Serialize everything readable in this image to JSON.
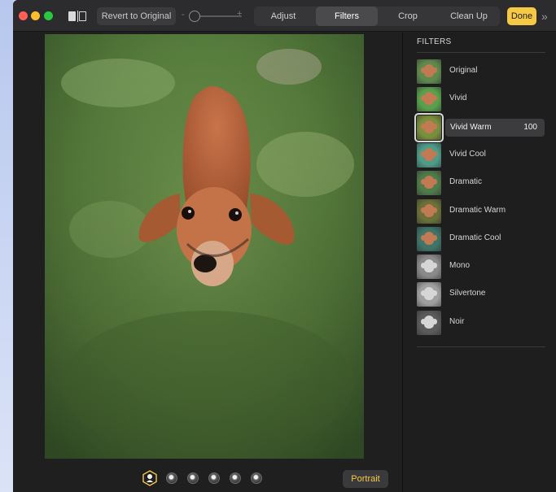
{
  "toolbar": {
    "revert_label": "Revert to Original",
    "zoom_minus": "-",
    "zoom_plus": "+",
    "tabs": [
      {
        "label": "Adjust",
        "active": false
      },
      {
        "label": "Filters",
        "active": true
      },
      {
        "label": "Crop",
        "active": false
      },
      {
        "label": "Clean Up",
        "active": false
      }
    ],
    "done_label": "Done",
    "more_glyph": "»"
  },
  "bottom": {
    "portrait_label": "Portrait",
    "lighting_options": [
      "natural",
      "studio",
      "contour",
      "stage",
      "stage-mono",
      "high-key-mono"
    ]
  },
  "sidebar": {
    "title": "FILTERS",
    "filters": [
      {
        "name": "Original",
        "tone": "#5e8a4e"
      },
      {
        "name": "Vivid",
        "tone": "#58a04c"
      },
      {
        "name": "Vivid Warm",
        "tone": "#7a8f3e",
        "selected": true,
        "value": "100"
      },
      {
        "name": "Vivid Cool",
        "tone": "#4f9a88"
      },
      {
        "name": "Dramatic",
        "tone": "#4f7a4a"
      },
      {
        "name": "Dramatic Warm",
        "tone": "#6a7038"
      },
      {
        "name": "Dramatic Cool",
        "tone": "#3f7468"
      },
      {
        "name": "Mono",
        "tone": "#8a8a8a"
      },
      {
        "name": "Silvertone",
        "tone": "#a0a0a0"
      },
      {
        "name": "Noir",
        "tone": "#5a5a5a"
      }
    ]
  },
  "colors": {
    "accent": "#f6c945",
    "grass": "#5e8a44",
    "dog": "#b5643a"
  }
}
